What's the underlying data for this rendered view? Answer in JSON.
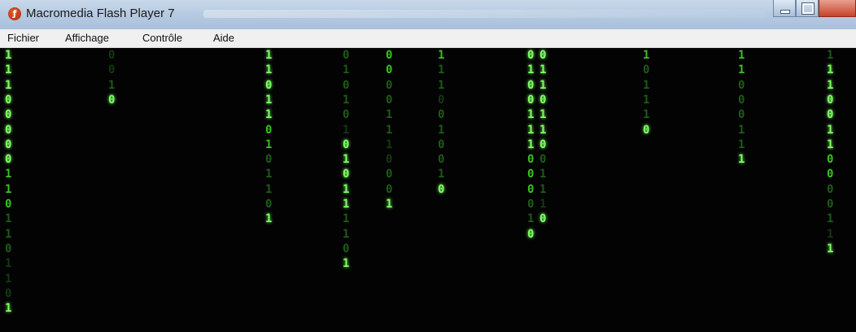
{
  "window": {
    "title": "Macromedia Flash Player 7",
    "icon": "flash-player-icon"
  },
  "menu": {
    "items": [
      "Fichier",
      "Affichage",
      "Contrôle",
      "Aide"
    ]
  },
  "colors": {
    "bright": "#7dff62",
    "mid": "#38c21f",
    "dim": "#1e5b18",
    "faint": "#143814",
    "background": "#030303"
  },
  "columns": [
    {
      "digits": [
        "1",
        "1",
        "1",
        "0",
        "0",
        "0",
        "0",
        "0",
        "1",
        "1",
        "0",
        "1",
        "1",
        "0",
        "1",
        "1",
        "0",
        "1"
      ],
      "levels": [
        3,
        3,
        3,
        3,
        3,
        3,
        3,
        3,
        2,
        2,
        2,
        1,
        1,
        1,
        0,
        0,
        0,
        3
      ]
    },
    {
      "digits": [
        "0",
        "0",
        "1",
        "0"
      ],
      "levels": [
        0,
        0,
        1,
        3
      ]
    },
    {
      "digits": [
        "1",
        "1",
        "0",
        "1",
        "1",
        "0",
        "1",
        "0",
        "1",
        "1",
        "0",
        "1"
      ],
      "levels": [
        3,
        3,
        3,
        3,
        3,
        2,
        2,
        1,
        1,
        1,
        1,
        3
      ]
    },
    {
      "digits": [
        "0",
        "1",
        "0",
        "1",
        "0",
        "1",
        "0",
        "1",
        "0",
        "1",
        "1",
        "1",
        "1",
        "0",
        "1"
      ],
      "levels": [
        1,
        1,
        1,
        1,
        1,
        0,
        3,
        3,
        3,
        3,
        3,
        1,
        1,
        1,
        3
      ]
    },
    {
      "digits": [
        "0",
        "0",
        "0",
        "0",
        "1",
        "1",
        "1",
        "0",
        "0",
        "0",
        "1"
      ],
      "levels": [
        2,
        2,
        1,
        1,
        1,
        1,
        0,
        0,
        1,
        1,
        3
      ]
    },
    {
      "digits": [
        "1",
        "1",
        "1",
        "0",
        "0",
        "1",
        "0",
        "0",
        "1",
        "0"
      ],
      "levels": [
        2,
        1,
        1,
        0,
        1,
        1,
        1,
        1,
        1,
        3
      ]
    },
    {
      "digits": [
        "0",
        "1",
        "0",
        "0",
        "1",
        "1",
        "1",
        "0",
        "0",
        "0",
        "0",
        "1",
        "0"
      ],
      "levels": [
        3,
        3,
        3,
        3,
        3,
        3,
        3,
        2,
        2,
        2,
        1,
        1,
        3
      ]
    },
    {
      "digits": [
        "0",
        "1",
        "1",
        "0",
        "1",
        "1",
        "0",
        "0",
        "1",
        "1",
        "1",
        "0"
      ],
      "levels": [
        3,
        3,
        3,
        3,
        3,
        3,
        3,
        1,
        1,
        1,
        0,
        3
      ]
    },
    {
      "digits": [
        "1",
        "0",
        "1",
        "1",
        "1",
        "0"
      ],
      "levels": [
        2,
        1,
        1,
        1,
        1,
        3
      ]
    },
    {
      "digits": [
        "1",
        "1",
        "0",
        "0",
        "0",
        "1",
        "1",
        "1"
      ],
      "levels": [
        2,
        2,
        1,
        1,
        1,
        1,
        1,
        3
      ]
    },
    {
      "digits": [
        "1",
        "1",
        "1",
        "0",
        "0",
        "1",
        "1",
        "0",
        "0",
        "0",
        "0",
        "1",
        "1",
        "1"
      ],
      "levels": [
        1,
        3,
        3,
        3,
        3,
        3,
        3,
        2,
        2,
        1,
        1,
        1,
        0,
        3
      ]
    }
  ]
}
